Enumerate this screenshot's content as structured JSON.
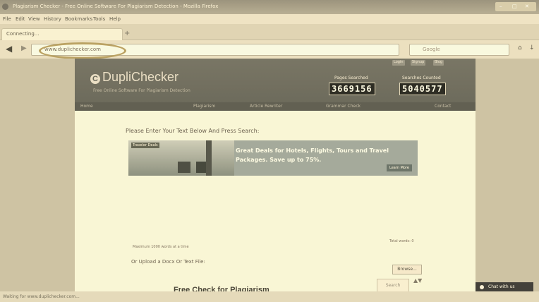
{
  "window": {
    "title": "Plagiarism Checker - Free Online Software For Plagiarism Detection - Mozilla Firefox",
    "buttons": [
      "–",
      "□",
      "✕"
    ]
  },
  "menu": [
    "File",
    "Edit",
    "View",
    "History",
    "Bookmarks",
    "Tools",
    "Help"
  ],
  "tab": {
    "label": "Connecting...",
    "new_tab": "+"
  },
  "nav": {
    "back": "◀",
    "forward": "▶",
    "url": "www.duplichecker.com",
    "search_placeholder": "Google",
    "icons": [
      "home-icon",
      "download-icon"
    ]
  },
  "site": {
    "logo": "DupliChecker",
    "tagline": "Free Online Software For Plagiarism Detection",
    "toplinks": [
      "Login",
      "Signup",
      "Blog"
    ],
    "counter1_label": "Pages Searched",
    "counter1_value": "3669156",
    "counter2_label": "Searches Counted",
    "counter2_value": "5040577",
    "nav_items": [
      "Home",
      "Plagiarism",
      "Article Rewriter",
      "Grammar Check",
      "Contact"
    ],
    "prompt": "Please Enter Your Text Below And Press Search:",
    "ad_badge": "Traveler Deals",
    "ad_text": "Great Deals for Hotels, Flights, Tours and Travel Packages. Save up to 75%.",
    "ad_cta": "Learn More",
    "limit_note": "Maximum 1000 words at a time",
    "total_words": "Total words: 0",
    "upload_label": "Or Upload a Docx Or Text File:",
    "browse": "Browse...",
    "free_check": "Free Check for Plagiarism",
    "check_button": "Search",
    "spinner": "▲▼"
  },
  "status": "Waiting for www.duplichecker.com...",
  "chat": {
    "label": "Chat with us"
  }
}
